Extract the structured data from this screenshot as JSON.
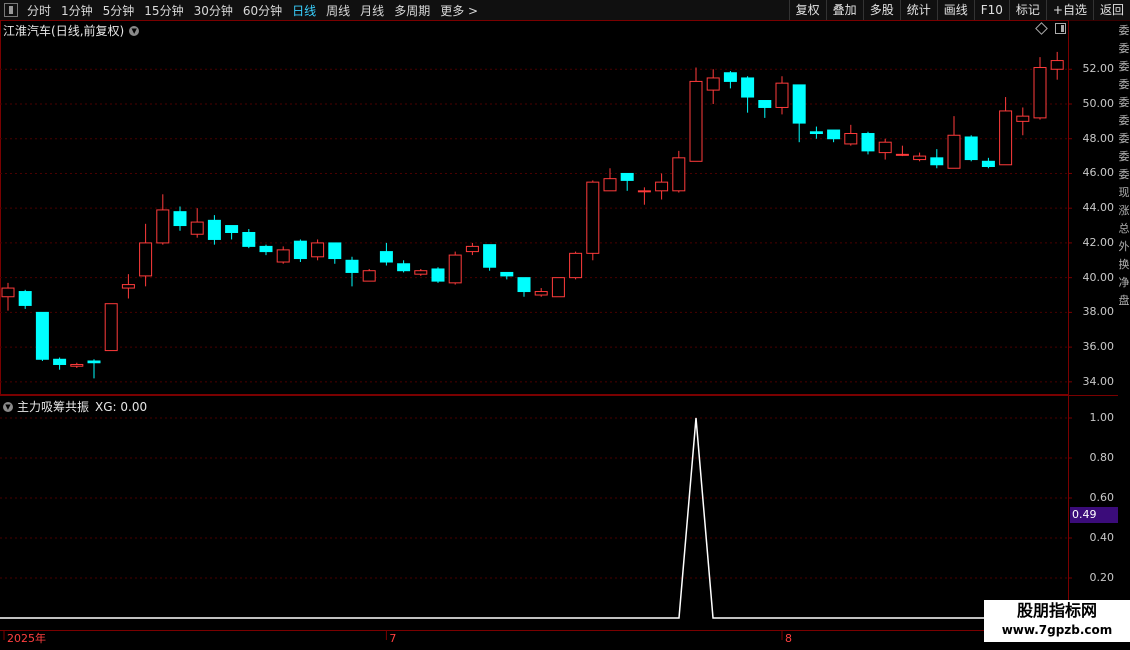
{
  "toolbar": {
    "periods": [
      {
        "label": "分时",
        "active": false
      },
      {
        "label": "1分钟",
        "active": false
      },
      {
        "label": "5分钟",
        "active": false
      },
      {
        "label": "15分钟",
        "active": false
      },
      {
        "label": "30分钟",
        "active": false
      },
      {
        "label": "60分钟",
        "active": false
      },
      {
        "label": "日线",
        "active": true
      },
      {
        "label": "周线",
        "active": false
      },
      {
        "label": "月线",
        "active": false
      },
      {
        "label": "多周期",
        "active": false
      },
      {
        "label": "更多 >",
        "active": false
      }
    ],
    "actions": [
      "复权",
      "叠加",
      "多股",
      "统计",
      "画线",
      "F10",
      "标记",
      "+自选",
      "返回"
    ]
  },
  "main_chart": {
    "stock_name": "江淮汽车",
    "params": "(日线,前复权)",
    "y_ticks": [
      "52.00",
      "50.00",
      "48.00",
      "46.00",
      "44.00",
      "42.00",
      "40.00",
      "38.00",
      "36.00",
      "34.00"
    ],
    "y_range": [
      33.3,
      53.8
    ]
  },
  "indicator": {
    "name": "主力吸筹共振",
    "value_label": "XG: 0.00",
    "y_ticks": [
      "1.00",
      "0.80",
      "0.60",
      "0.40",
      "0.20"
    ],
    "crosshair_value": "0.49"
  },
  "x_axis": {
    "labels": [
      {
        "text": "2025年",
        "index": 0
      },
      {
        "text": "7",
        "index": 22
      },
      {
        "text": "8",
        "index": 45
      }
    ]
  },
  "right_strip": [
    "委",
    "委",
    "委",
    "委",
    "委",
    "委",
    "委",
    "委",
    "委",
    "现",
    "涨",
    "总",
    "外",
    "换",
    "净",
    "盘"
  ],
  "watermark": {
    "line1": "股朋指标网",
    "line2": "www.7gpzb.com"
  },
  "colors": {
    "up": "#ff3b3b",
    "down": "#00ffff",
    "grid": "#4a0000",
    "axis": "#7a0000",
    "line": "#ffffff"
  },
  "chart_data": {
    "type": "candlestick",
    "ohlc": [
      [
        38.9,
        39.4,
        38.1,
        39.7
      ],
      [
        39.2,
        38.4,
        38.2,
        39.3
      ],
      [
        38.0,
        35.3,
        35.2,
        38.0
      ],
      [
        35.3,
        35.0,
        34.7,
        35.4
      ],
      [
        34.9,
        35.0,
        34.8,
        35.1
      ],
      [
        35.2,
        35.1,
        34.2,
        35.3
      ],
      [
        35.8,
        38.5,
        35.8,
        38.5
      ],
      [
        39.4,
        39.6,
        38.8,
        40.2
      ],
      [
        40.1,
        42.0,
        39.5,
        43.1
      ],
      [
        42.0,
        43.9,
        41.9,
        44.8
      ],
      [
        43.8,
        43.0,
        42.7,
        44.1
      ],
      [
        42.5,
        43.2,
        42.3,
        44.0
      ],
      [
        43.3,
        42.2,
        41.9,
        43.6
      ],
      [
        43.0,
        42.6,
        42.2,
        43.0
      ],
      [
        42.6,
        41.8,
        41.7,
        42.8
      ],
      [
        41.8,
        41.5,
        41.3,
        41.9
      ],
      [
        40.9,
        41.6,
        40.8,
        41.8
      ],
      [
        42.1,
        41.1,
        40.9,
        42.2
      ],
      [
        41.2,
        42.0,
        41.0,
        42.2
      ],
      [
        42.0,
        41.1,
        40.8,
        42.0
      ],
      [
        41.0,
        40.3,
        39.5,
        41.2
      ],
      [
        39.8,
        40.4,
        39.8,
        40.5
      ],
      [
        41.5,
        40.9,
        40.7,
        42.0
      ],
      [
        40.8,
        40.4,
        40.3,
        41.0
      ],
      [
        40.2,
        40.4,
        40.1,
        40.5
      ],
      [
        40.5,
        39.8,
        39.7,
        40.6
      ],
      [
        39.7,
        41.3,
        39.6,
        41.5
      ],
      [
        41.5,
        41.8,
        41.3,
        42.0
      ],
      [
        41.9,
        40.6,
        40.4,
        41.9
      ],
      [
        40.3,
        40.1,
        39.9,
        40.3
      ],
      [
        40.0,
        39.2,
        38.9,
        40.0
      ],
      [
        39.0,
        39.2,
        38.9,
        39.4
      ],
      [
        38.9,
        40.0,
        38.9,
        40.0
      ],
      [
        40.0,
        41.4,
        39.9,
        41.5
      ],
      [
        41.4,
        45.5,
        41.0,
        45.6
      ],
      [
        45.0,
        45.7,
        45.0,
        46.3
      ],
      [
        46.0,
        45.6,
        45.0,
        46.0
      ],
      [
        45.0,
        45.0,
        44.2,
        45.2
      ],
      [
        45.0,
        45.5,
        44.5,
        46.0
      ],
      [
        45.0,
        46.9,
        44.9,
        47.3
      ],
      [
        46.7,
        51.3,
        46.7,
        52.1
      ],
      [
        50.8,
        51.5,
        50.0,
        52.0
      ],
      [
        51.8,
        51.3,
        50.9,
        51.9
      ],
      [
        51.5,
        50.4,
        49.5,
        51.6
      ],
      [
        50.2,
        49.8,
        49.2,
        50.2
      ],
      [
        49.8,
        51.2,
        49.4,
        51.6
      ],
      [
        51.1,
        48.9,
        47.8,
        51.1
      ],
      [
        48.4,
        48.3,
        48.0,
        48.7
      ],
      [
        48.5,
        48.0,
        47.8,
        48.5
      ],
      [
        47.7,
        48.3,
        47.6,
        48.8
      ],
      [
        48.3,
        47.3,
        47.1,
        48.4
      ],
      [
        47.2,
        47.8,
        46.8,
        48.0
      ],
      [
        47.1,
        47.1,
        47.0,
        47.6
      ],
      [
        46.8,
        47.0,
        46.7,
        47.2
      ],
      [
        46.9,
        46.5,
        46.3,
        47.4
      ],
      [
        46.3,
        48.2,
        46.3,
        49.3
      ],
      [
        48.1,
        46.8,
        46.7,
        48.2
      ],
      [
        46.7,
        46.4,
        46.3,
        46.9
      ],
      [
        46.5,
        49.6,
        46.5,
        50.4
      ],
      [
        49.0,
        49.3,
        48.2,
        49.8
      ],
      [
        49.2,
        52.1,
        49.1,
        52.7
      ],
      [
        52.0,
        52.5,
        51.4,
        53.0
      ]
    ],
    "signal": {
      "baseline": 0,
      "peak": 1.0,
      "peak_index": 40
    },
    "crosshair": 0.49
  }
}
